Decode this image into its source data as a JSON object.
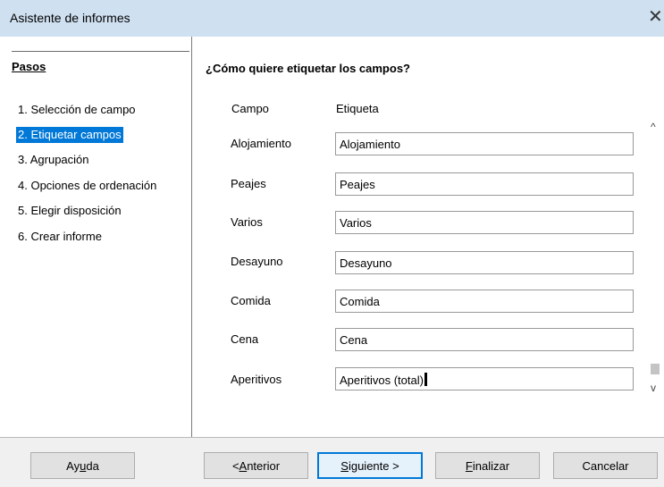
{
  "window": {
    "title": "Asistente de informes"
  },
  "sidebar": {
    "header": "Pasos",
    "steps": [
      "1. Selección de campo",
      "2. Etiquetar campos",
      "3. Agrupación",
      "4. Opciones de ordenación",
      "5. Elegir disposición",
      "6. Crear informe"
    ],
    "active_step": 1
  },
  "main": {
    "question": "¿Cómo quiere etiquetar los campos?",
    "col_field": "Campo",
    "col_label": "Etiqueta",
    "fields": [
      {
        "name": "Alojamiento",
        "label": "Alojamiento"
      },
      {
        "name": "Peajes",
        "label": "Peajes"
      },
      {
        "name": "Varios",
        "label": "Varios"
      },
      {
        "name": "Desayuno",
        "label": "Desayuno"
      },
      {
        "name": "Comida",
        "label": "Comida"
      },
      {
        "name": "Cena",
        "label": "Cena"
      },
      {
        "name": "Aperitivos",
        "label": "Aperitivos (total)"
      }
    ]
  },
  "buttons": {
    "help": {
      "pre": "Ay",
      "u": "u",
      "post": "da"
    },
    "back": {
      "pre": "< ",
      "u": "A",
      "post": "nterior"
    },
    "next": {
      "pre": "",
      "u": "S",
      "post": "iguiente >"
    },
    "finish": {
      "pre": "",
      "u": "F",
      "post": "inalizar"
    },
    "cancel": {
      "pre": "Cancelar",
      "u": "",
      "post": ""
    }
  }
}
